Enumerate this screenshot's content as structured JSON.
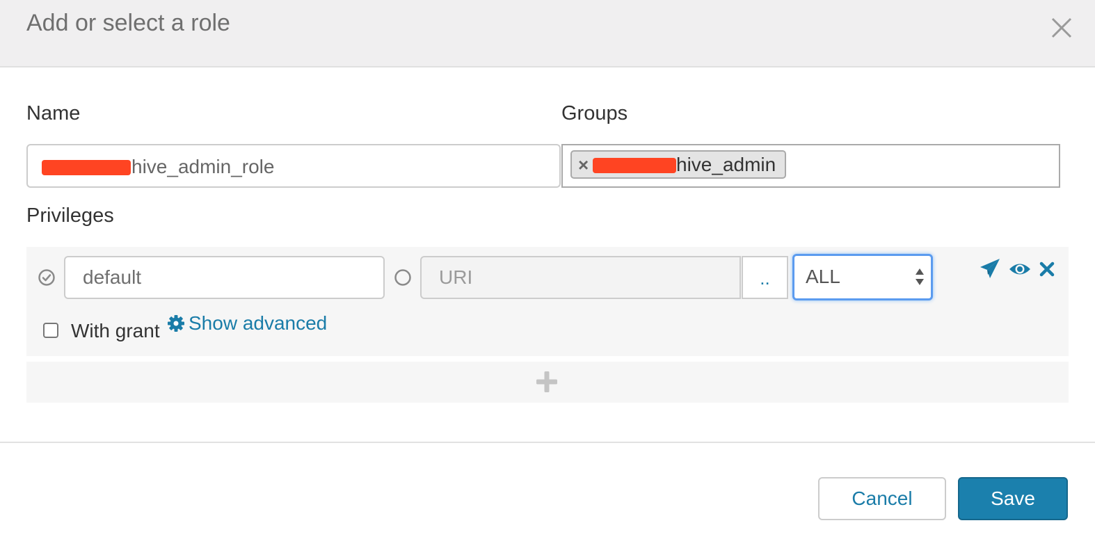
{
  "dialog": {
    "title": "Add or select a role"
  },
  "form": {
    "name_label": "Name",
    "name_value": "hive_admin_role",
    "groups_label": "Groups",
    "groups": [
      {
        "label": "hive_admin"
      }
    ],
    "privileges_label": "Privileges"
  },
  "privilege": {
    "database_value": "default",
    "uri_placeholder": "URI",
    "browse_label": "..",
    "action_value": "ALL",
    "with_grant_label": "With grant",
    "with_grant_checked": false,
    "show_advanced_label": "Show advanced",
    "icons": [
      "send-icon",
      "eye-icon",
      "remove-icon"
    ]
  },
  "footer": {
    "cancel_label": "Cancel",
    "save_label": "Save"
  },
  "colors": {
    "accent": "#1b80ad",
    "link": "#1a7ca8",
    "redaction": "#ff4422",
    "focus": "#5b9bef"
  }
}
